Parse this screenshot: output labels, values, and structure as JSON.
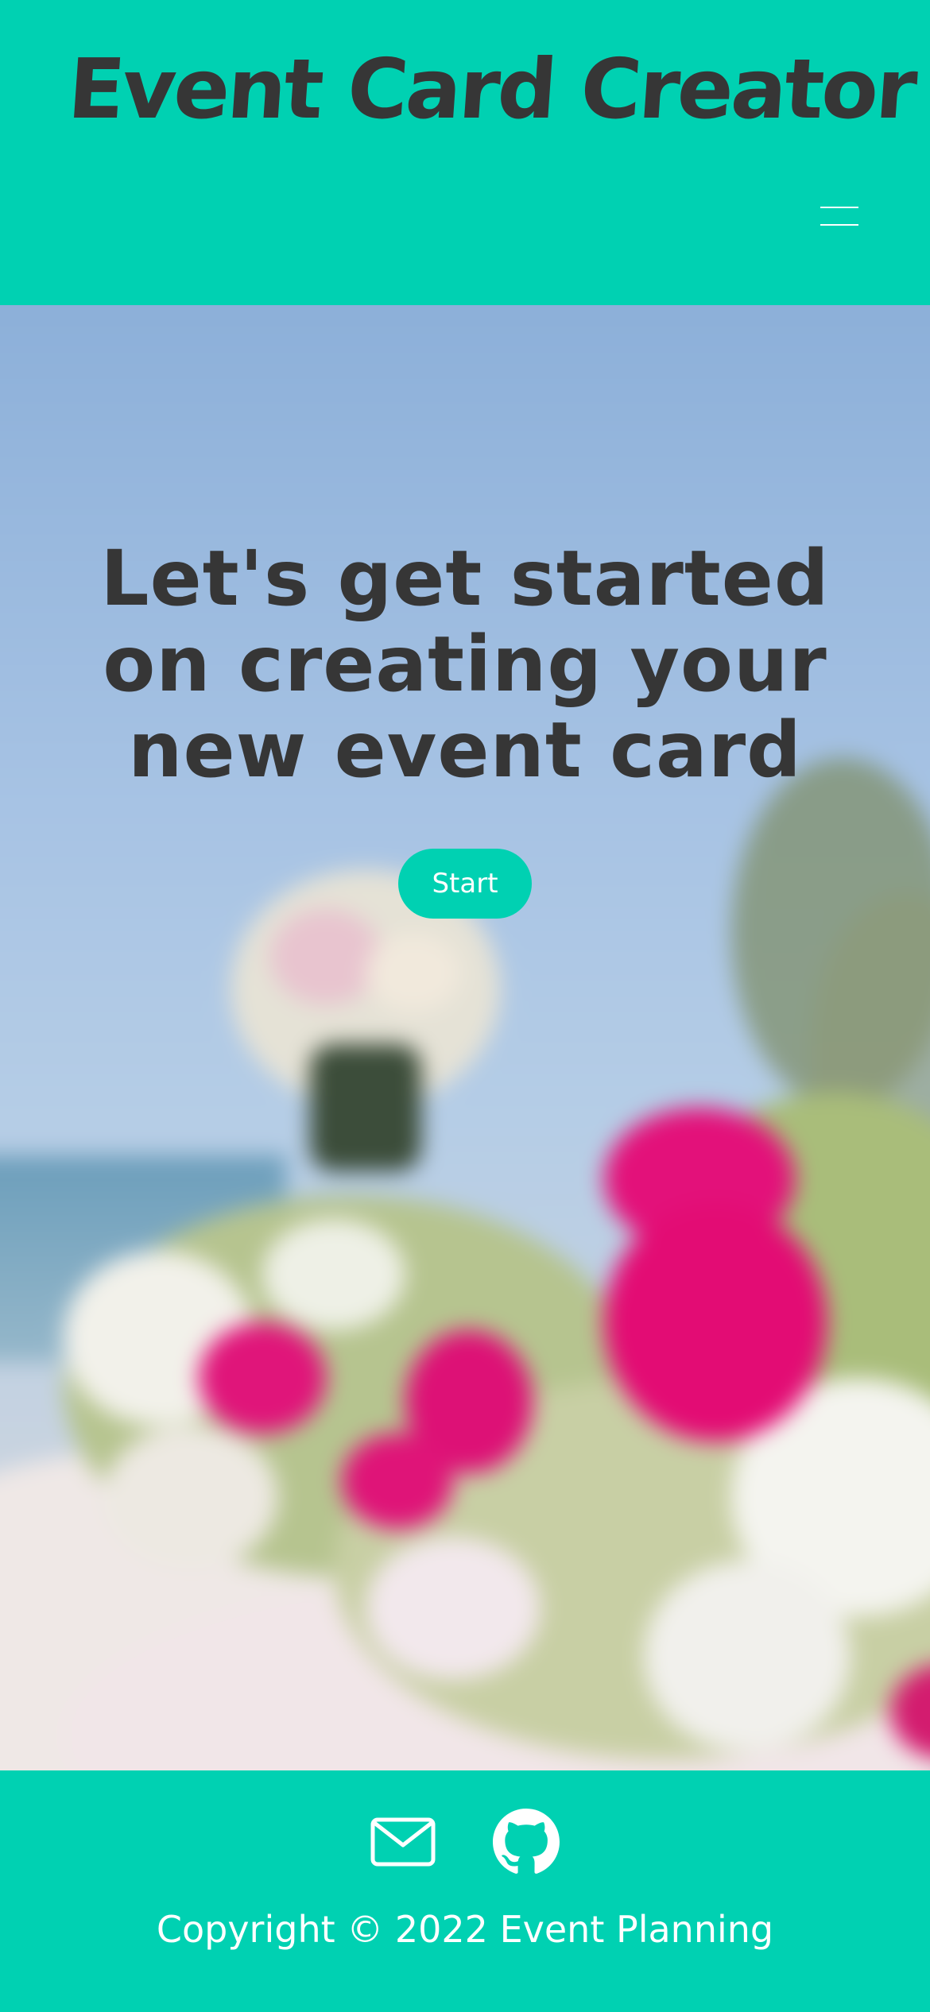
{
  "header": {
    "brand": "Event Card Creator",
    "menu_icon": "hamburger-icon"
  },
  "hero": {
    "title": "Let's get started on creating your new event card",
    "start_label": "Start",
    "background": "blurred-flower-bouquet-photo"
  },
  "footer": {
    "email_icon": "envelope-icon",
    "github_icon": "github-icon",
    "copyright": "Copyright © 2022 Event Planning"
  },
  "colors": {
    "primary": "#00d1b2",
    "text_dark": "#363636",
    "text_light": "#ffffff"
  }
}
